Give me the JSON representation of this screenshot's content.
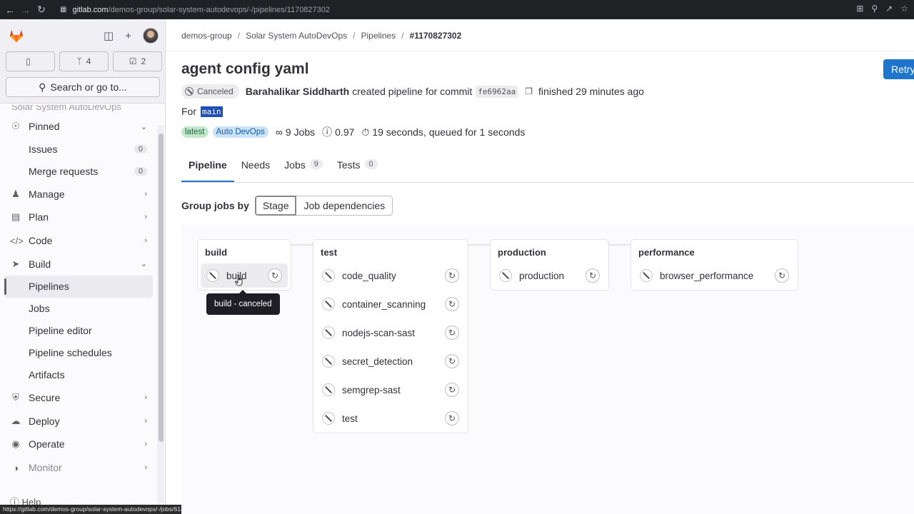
{
  "browser": {
    "url_domain": "gitlab.com",
    "url_path": "/demos-group/solar-system-autodevops/-/pipelines/1170827302",
    "status_url": "https://gitlab.com/demos-group/solar-system-autodevops/-/jobs/6136310196"
  },
  "sidebar": {
    "counters": {
      "issues": "",
      "merge_requests": "4",
      "todos": "2"
    },
    "search_label": "Search or go to...",
    "project_cut": "Solar System AutoDevOps",
    "items": [
      {
        "label": "Pinned",
        "icon": "pin-icon",
        "chevron": "down"
      },
      {
        "label": "Issues",
        "badge": "0",
        "sub": true
      },
      {
        "label": "Merge requests",
        "badge": "0",
        "sub": true
      },
      {
        "label": "Manage",
        "icon": "users-icon",
        "chevron": "right"
      },
      {
        "label": "Plan",
        "icon": "calendar-icon",
        "chevron": "right"
      },
      {
        "label": "Code",
        "icon": "code-icon",
        "chevron": "right"
      },
      {
        "label": "Build",
        "icon": "rocket-icon",
        "chevron": "down"
      },
      {
        "label": "Pipelines",
        "sub": true,
        "active": true
      },
      {
        "label": "Jobs",
        "sub": true
      },
      {
        "label": "Pipeline editor",
        "sub": true
      },
      {
        "label": "Pipeline schedules",
        "sub": true
      },
      {
        "label": "Artifacts",
        "sub": true
      },
      {
        "label": "Secure",
        "icon": "shield-icon",
        "chevron": "right"
      },
      {
        "label": "Deploy",
        "icon": "deploy-icon",
        "chevron": "right"
      },
      {
        "label": "Operate",
        "icon": "operate-icon",
        "chevron": "right"
      },
      {
        "label": "Monitor",
        "icon": "monitor-icon",
        "chevron": "right"
      }
    ],
    "help_label": "Help"
  },
  "breadcrumb": [
    "demos-group",
    "Solar System AutoDevOps",
    "Pipelines",
    "#1170827302"
  ],
  "header": {
    "retry_label": "Retry",
    "title": "agent config yaml",
    "status": "Canceled",
    "author": "Barahalikar Siddharth",
    "created_text": "created pipeline for commit",
    "commit_sha": "fe6962aa",
    "finished_text": "finished 29 minutes ago",
    "for_label": "For",
    "branch": "main",
    "tags": [
      "latest",
      "Auto DevOps"
    ],
    "jobs_text": "9 Jobs",
    "score_text": "0.97",
    "duration_text": "19 seconds, queued for 1 seconds"
  },
  "tabs": [
    {
      "label": "Pipeline",
      "count": "",
      "active": true
    },
    {
      "label": "Needs",
      "count": ""
    },
    {
      "label": "Jobs",
      "count": "9"
    },
    {
      "label": "Tests",
      "count": "0"
    }
  ],
  "group_by": {
    "label": "Group jobs by",
    "options": [
      "Stage",
      "Job dependencies"
    ],
    "selected": "Stage"
  },
  "stages": [
    {
      "name": "build",
      "jobs": [
        "build"
      ]
    },
    {
      "name": "test",
      "jobs": [
        "code_quality",
        "container_scanning",
        "nodejs-scan-sast",
        "secret_detection",
        "semgrep-sast",
        "test"
      ]
    },
    {
      "name": "production",
      "jobs": [
        "production"
      ]
    },
    {
      "name": "performance",
      "jobs": [
        "browser_performance"
      ]
    }
  ],
  "tooltip": "build - canceled"
}
